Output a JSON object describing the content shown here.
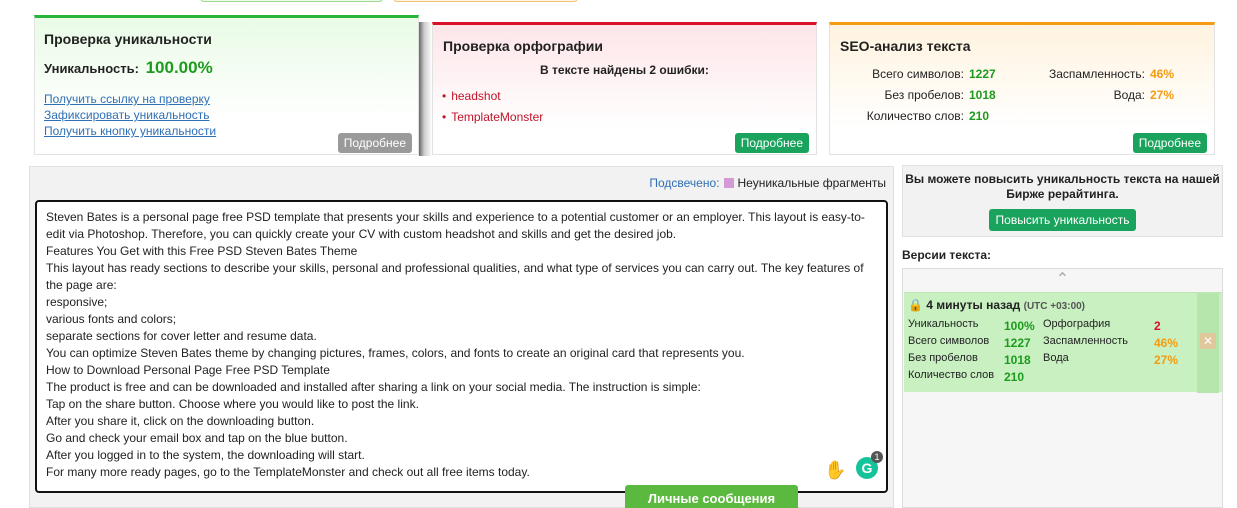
{
  "panels": {
    "uniqueness": {
      "title": "Проверка уникальности",
      "label": "Уникальность:",
      "value": "100.00%",
      "links": [
        "Получить ссылку на проверку",
        "Зафиксировать уникальность",
        "Получить кнопку уникальности"
      ],
      "more": "Подробнее"
    },
    "spelling": {
      "title": "Проверка орфографии",
      "found": "В тексте найдены 2 ошибки:",
      "errors": [
        "headshot",
        "TemplateMonster"
      ],
      "more": "Подробнее"
    },
    "seo": {
      "title": "SEO-анализ текста",
      "total_label": "Всего символов:",
      "total": "1227",
      "nospace_label": "Без пробелов:",
      "nospace": "1018",
      "words_label": "Количество слов:",
      "words": "210",
      "spam_label": "Заспамленность:",
      "spam": "46%",
      "water_label": "Вода:",
      "water": "27%",
      "more": "Подробнее"
    }
  },
  "main": {
    "legend_link": "Подсвечено:",
    "legend_text": "Неуникальные фрагменты",
    "lines": [
      "Steven Bates is a personal page free PSD template that presents your skills and experience to a potential customer or an employer. This layout is easy-to-edit via Photoshop. Therefore, you can quickly create your CV with custom headshot and skills and get the desired job.",
      "Features You Get with this Free PSD Steven Bates Theme",
      "This layout has ready sections to describe your skills, personal and professional qualities, and what type of services you can carry out. The key features of the page are:",
      "responsive;",
      "various fonts and colors;",
      "separate sections for cover letter and resume data.",
      "You can optimize Steven Bates theme by changing pictures, frames, colors, and fonts to create an original card that represents you.",
      "How to Download Personal Page Free PSD Template",
      "The product is free and can be downloaded and installed after sharing a link on your social media. The instruction is simple:",
      "Tap on the share button. Choose where you would like to post the link.",
      "After you share it, click on the downloading button.",
      "Go and check your email box and tap on the blue button.",
      "After you logged in to the system, the downloading will start.",
      "For many more ready pages, go to the TemplateMonster and check out all free items today."
    ],
    "grammarly_count": "1",
    "messages_button": "Личные сообщения"
  },
  "sidebar": {
    "promo_text": "Вы можете повысить уникальность текста на нашей Бирже рерайтинга.",
    "promo_button": "Повысить уникальность",
    "versions_title": "Версии текста:",
    "version": {
      "time": "4 минуты назад",
      "tz": "(UTC +03:00)",
      "uniq_label": "Уникальность",
      "uniq": "100%",
      "spell_label": "Орфография",
      "spell": "2",
      "total_label": "Всего символов",
      "total": "1227",
      "spam_label": "Заспамленность",
      "spam": "46%",
      "nospace_label": "Без пробелов",
      "nospace": "1018",
      "water_label": "Вода",
      "water": "27%",
      "words_label": "Количество слов",
      "words": "210"
    }
  },
  "colors": {
    "green": "#1d9b1d",
    "red": "#d8102a",
    "orange": "#f39c12",
    "button_green": "#1aa35c"
  }
}
